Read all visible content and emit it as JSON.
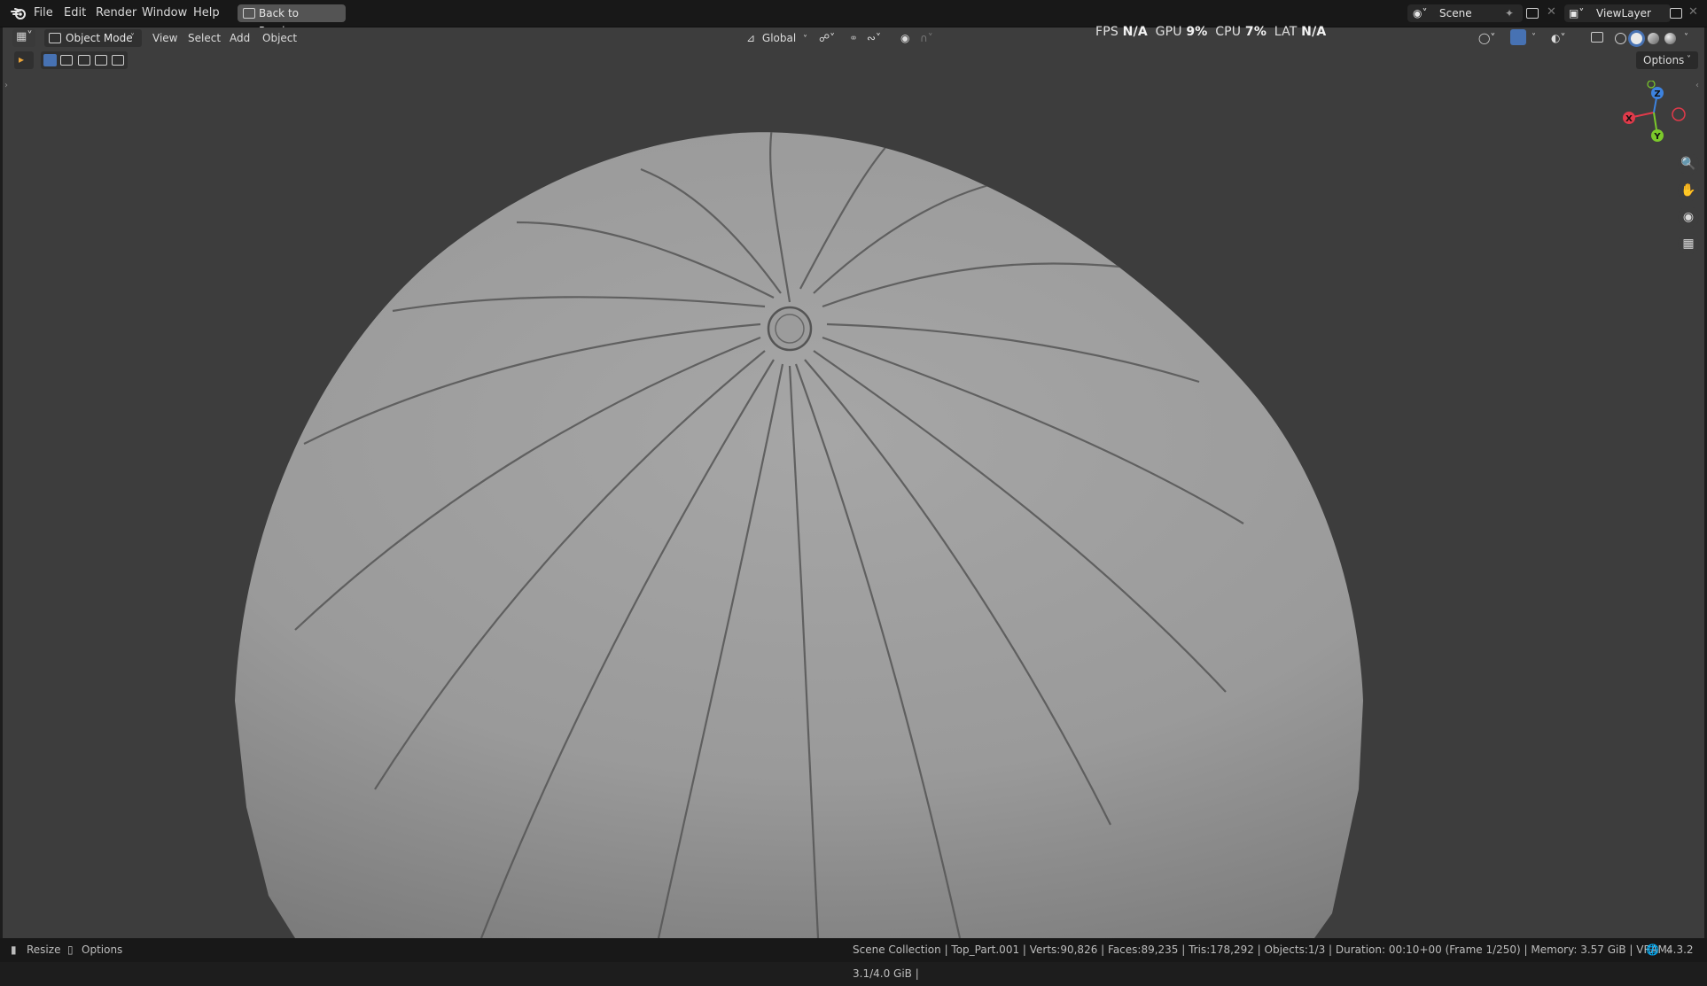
{
  "topbar": {
    "menus": [
      "File",
      "Edit",
      "Render",
      "Window",
      "Help"
    ],
    "back_button": "Back to Previous",
    "scene_name": "Scene",
    "view_layer": "ViewLayer"
  },
  "header": {
    "mode": "Object Mode",
    "menus": [
      "View",
      "Select",
      "Add",
      "Object"
    ],
    "transform_orientation": "Global",
    "options_label": "Options"
  },
  "stats": {
    "fps_label": "FPS",
    "fps_value": "N/A",
    "gpu_label": "GPU",
    "gpu_value": "9%",
    "cpu_label": "CPU",
    "cpu_value": "7%",
    "lat_label": "LAT",
    "lat_value": "N/A"
  },
  "gizmo": {
    "x": "X",
    "y": "Y",
    "z": "Z"
  },
  "statusbar": {
    "left_action": "Resize",
    "left_options": "Options",
    "info": "Scene Collection | Top_Part.001 | Verts:90,826 | Faces:89,235 | Tris:178,292 | Objects:1/3 | Duration: 00:10+00 (Frame 1/250) | Memory: 3.57 GiB | VRAM: 3.1/4.0 GiB |",
    "version": "4.3.2"
  },
  "colors": {
    "viewport_bg": "#3d3d3d",
    "topbar_bg": "#181818",
    "axis_x": "#e03a4a",
    "axis_y": "#7bc92b",
    "axis_z": "#3d83e0",
    "active_blue": "#4772b3"
  }
}
